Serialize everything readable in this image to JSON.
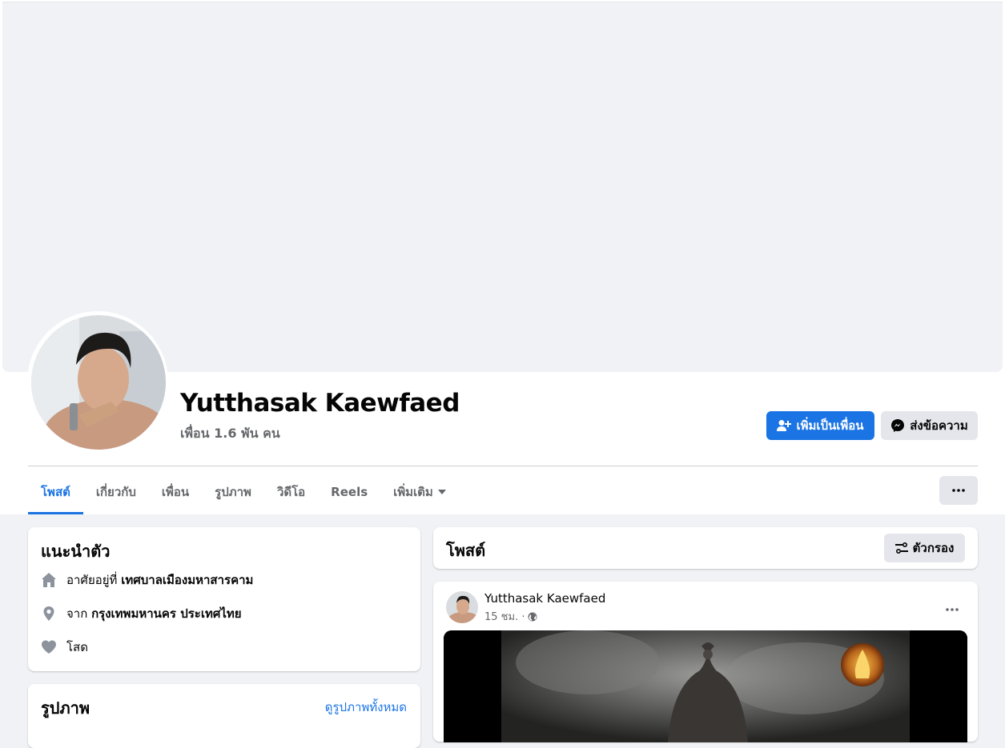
{
  "profile": {
    "name": "Yutthasak Kaewfaed",
    "friends": "เพื่อน 1.6 พัน คน"
  },
  "actions": {
    "add_friend": "เพิ่มเป็นเพื่อน",
    "message": "ส่งข้อความ"
  },
  "tabs": [
    {
      "label": "โพสต์",
      "active": true
    },
    {
      "label": "เกี่ยวกับ"
    },
    {
      "label": "เพื่อน"
    },
    {
      "label": "รูปภาพ"
    },
    {
      "label": "วิดีโอ"
    },
    {
      "label": "Reels"
    },
    {
      "label": "เพิ่มเติม"
    }
  ],
  "intro": {
    "title": "แนะนำตัว",
    "lives_prefix": "อาศัยอยู่ที่",
    "lives_value": "เทศบาลเมืองมหาสารคาม",
    "from_prefix": "จาก",
    "from_value": "กรุงเทพมหานคร ประเทศไทย",
    "relationship": "โสด"
  },
  "photos": {
    "title": "รูปภาพ",
    "see_all": "ดูรูปภาพทั้งหมด"
  },
  "posts": {
    "title": "โพสต์",
    "filter": "ตัวกรอง"
  },
  "post": {
    "author": "Yutthasak Kaewfaed",
    "time": "15 ชม. ·"
  },
  "colors": {
    "accent": "#1b74e4",
    "background": "#f0f2f5",
    "secondary_text": "#65676b"
  }
}
